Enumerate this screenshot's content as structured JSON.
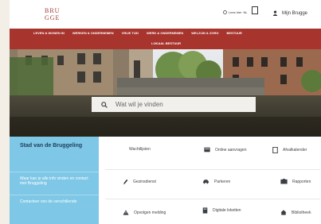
{
  "header": {
    "logo_lines": [
      "BRU",
      "GGE"
    ],
    "language_label": "Lees hier",
    "language_code": "NL",
    "login_label": "Mijn Brugge"
  },
  "nav": {
    "items": [
      "LEVEN & WONEN IN",
      "WERKEN & ONDERNEMEN",
      "VRIJE TIJD",
      "WERK & ONDERNEMEN",
      "WELZIJN & ZORG",
      "BESTUUR"
    ],
    "second_row": "LOKAAL BESTUUR"
  },
  "search": {
    "placeholder": "Wat wil je vinden"
  },
  "sidebar": {
    "title": "Stad van de Bruggeling",
    "links": [
      "Waar kan je alle info vinden en contact met Bruggeling",
      "Contacteer ons de verschillende"
    ]
  },
  "services": [
    {
      "label": "Wachtlijsten",
      "icon": "house-icon"
    },
    {
      "label": "Online aanvragen",
      "icon": "card-icon"
    },
    {
      "label": "Afvalkalender",
      "icon": "calendar-icon"
    },
    {
      "label": "Gezinsdienst",
      "icon": "pen-icon"
    },
    {
      "label": "Parkeren",
      "icon": "car-icon"
    },
    {
      "label": "Rapporten",
      "icon": "folder-icon"
    },
    {
      "label": "Opvolgen melding",
      "icon": "warning-icon"
    },
    {
      "label": "Digitale loketten",
      "icon": "building-icon"
    },
    {
      "label": "Bibliotheek",
      "icon": "home-icon"
    }
  ],
  "colors": {
    "brand_red": "#a8342e",
    "panel_blue": "#7ec7e6"
  }
}
